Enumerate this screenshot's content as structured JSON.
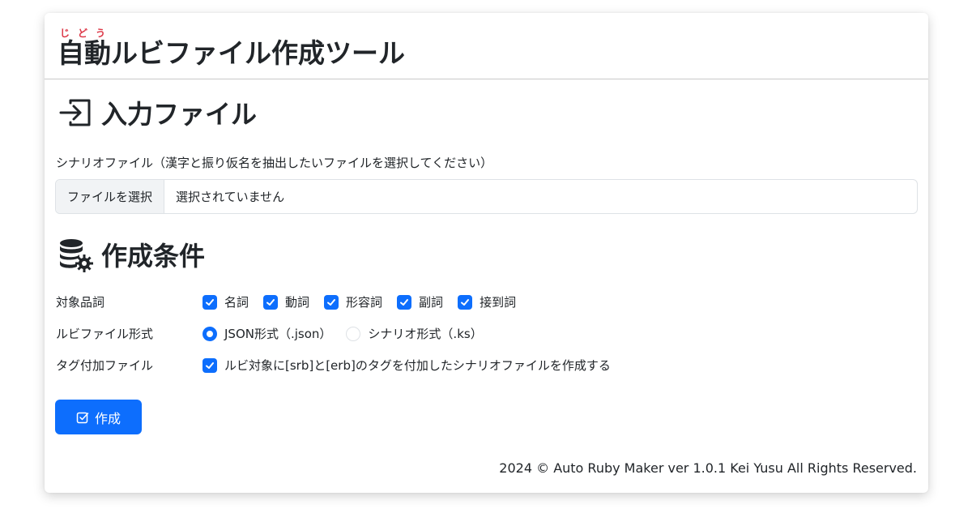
{
  "header": {
    "title_ruby_base": "自動",
    "title_ruby_reading": "じどう",
    "title_rest": "ルビファイル作成ツール"
  },
  "input_section": {
    "title": "入力ファイル",
    "icon": "box-arrow-in-right-icon",
    "field_label": "シナリオファイル（漢字と振り仮名を抽出したいファイルを選択してください）",
    "file_button": "ファイルを選択",
    "file_status": "選択されていません"
  },
  "condition_section": {
    "title": "作成条件",
    "icon": "database-gear-icon",
    "pos": {
      "label": "対象品詞",
      "options": [
        {
          "label": "名詞",
          "checked": true
        },
        {
          "label": "動詞",
          "checked": true
        },
        {
          "label": "形容詞",
          "checked": true
        },
        {
          "label": "副詞",
          "checked": true
        },
        {
          "label": "接到詞",
          "checked": true
        }
      ]
    },
    "format": {
      "label": "ルビファイル形式",
      "options": [
        {
          "label": "JSON形式（.json）",
          "selected": true
        },
        {
          "label": "シナリオ形式（.ks）",
          "selected": false
        }
      ]
    },
    "tag": {
      "label": "タグ付加ファイル",
      "option": {
        "label": "ルビ対象に[srb]と[erb]のタグを付加したシナリオファイルを作成する",
        "checked": true
      }
    }
  },
  "actions": {
    "create_label": "作成",
    "create_icon": "check-square-icon"
  },
  "footer": {
    "text": "2024 © Auto Ruby Maker ver 1.0.1 Kei Yusu All Rights Reserved."
  },
  "colors": {
    "primary": "#0d6efd",
    "ruby": "#dc3545"
  }
}
